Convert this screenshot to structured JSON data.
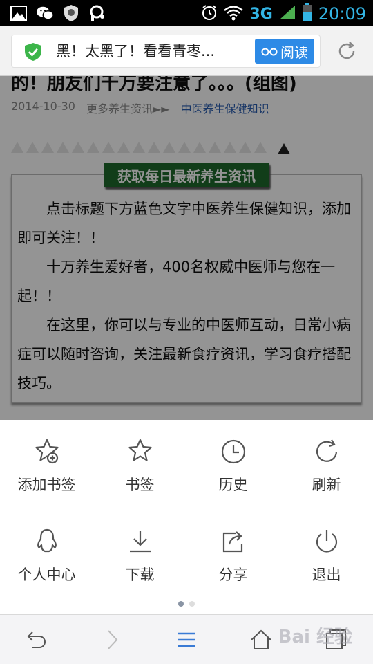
{
  "status_bar": {
    "network": "3G",
    "time": "20:09",
    "icons": [
      "image-icon",
      "wechat-icon",
      "app-badge-icon",
      "notification-icon",
      "alarm-icon",
      "wifi-icon",
      "signal-icon",
      "battery-icon"
    ]
  },
  "address_bar": {
    "page_title": "黑！太黑了！看看青枣...",
    "read_button_label": "阅读",
    "icons": [
      "shield-check-icon",
      "glasses-icon",
      "reload-icon"
    ]
  },
  "article": {
    "title_fragment": "的！朋友们千万要注意了。。。(组图)",
    "date": "2014-10-30",
    "more_link": "更多养生资讯►►",
    "category_link": "中医养生保健知识",
    "banner": "获取每日最新养生资讯",
    "paragraphs": [
      "点击标题下方蓝色文字中医养生保健知识，添加即可关注！！",
      "十万养生爱好者，400名权威中医师与您在一起！！",
      "在这里，你可以与专业的中医师互动，日常小病症可以随时咨询，关注最新食疗资讯，学习食疗搭配技巧。"
    ]
  },
  "menu": {
    "items": [
      {
        "label": "添加书签",
        "icon": "add-bookmark-icon"
      },
      {
        "label": "书签",
        "icon": "star-icon"
      },
      {
        "label": "历史",
        "icon": "clock-icon"
      },
      {
        "label": "刷新",
        "icon": "refresh-icon"
      },
      {
        "label": "个人中心",
        "icon": "qq-penguin-icon"
      },
      {
        "label": "下载",
        "icon": "download-icon"
      },
      {
        "label": "分享",
        "icon": "share-icon"
      },
      {
        "label": "退出",
        "icon": "power-icon"
      }
    ],
    "page_indicator": {
      "current": 1,
      "total": 2
    }
  },
  "toolbar": {
    "icons": [
      "back-icon",
      "forward-icon",
      "menu-icon",
      "home-icon",
      "tabs-icon"
    ]
  },
  "watermark": "Bai 经验",
  "colors": {
    "accent_blue": "#2d8ae6",
    "status_blue": "#33b5e5",
    "banner_green": "#1e6a2c",
    "toolbar_blue": "#3a7bd5"
  }
}
